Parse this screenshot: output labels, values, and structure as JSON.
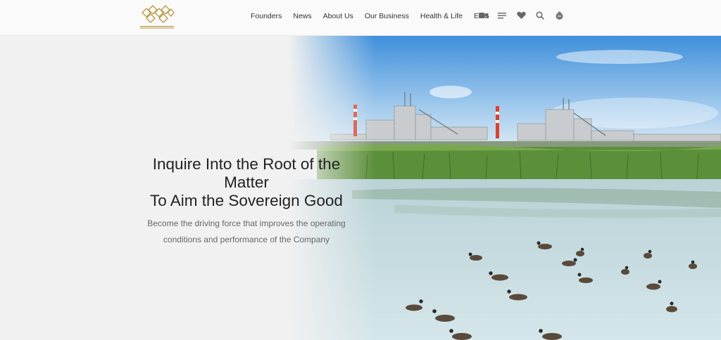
{
  "header": {
    "logo_name": "company-logo",
    "nav": [
      {
        "label": "Founders"
      },
      {
        "label": "News"
      },
      {
        "label": "About Us"
      },
      {
        "label": "Our Business"
      },
      {
        "label": "Health & Life"
      },
      {
        "label": "ESG"
      }
    ],
    "icons": [
      "video-icon",
      "menu-icon",
      "heart-icon",
      "search-icon",
      "language-icon"
    ]
  },
  "hero": {
    "title_line1": "Inquire Into the Root of the",
    "title_line2": "Matter",
    "title_line3": "To Aim the Sovereign Good",
    "subtitle_line1": "Become the driving force that improves the operating",
    "subtitle_line2": "conditions and performance of the Company"
  },
  "colors": {
    "brand_gold": "#b8963e",
    "header_bg": "#fafafa",
    "hero_left_bg": "#f1f1f1",
    "sky": "#5ea3de",
    "water": "#c7dde2",
    "reeds": "#5c8f3a"
  }
}
